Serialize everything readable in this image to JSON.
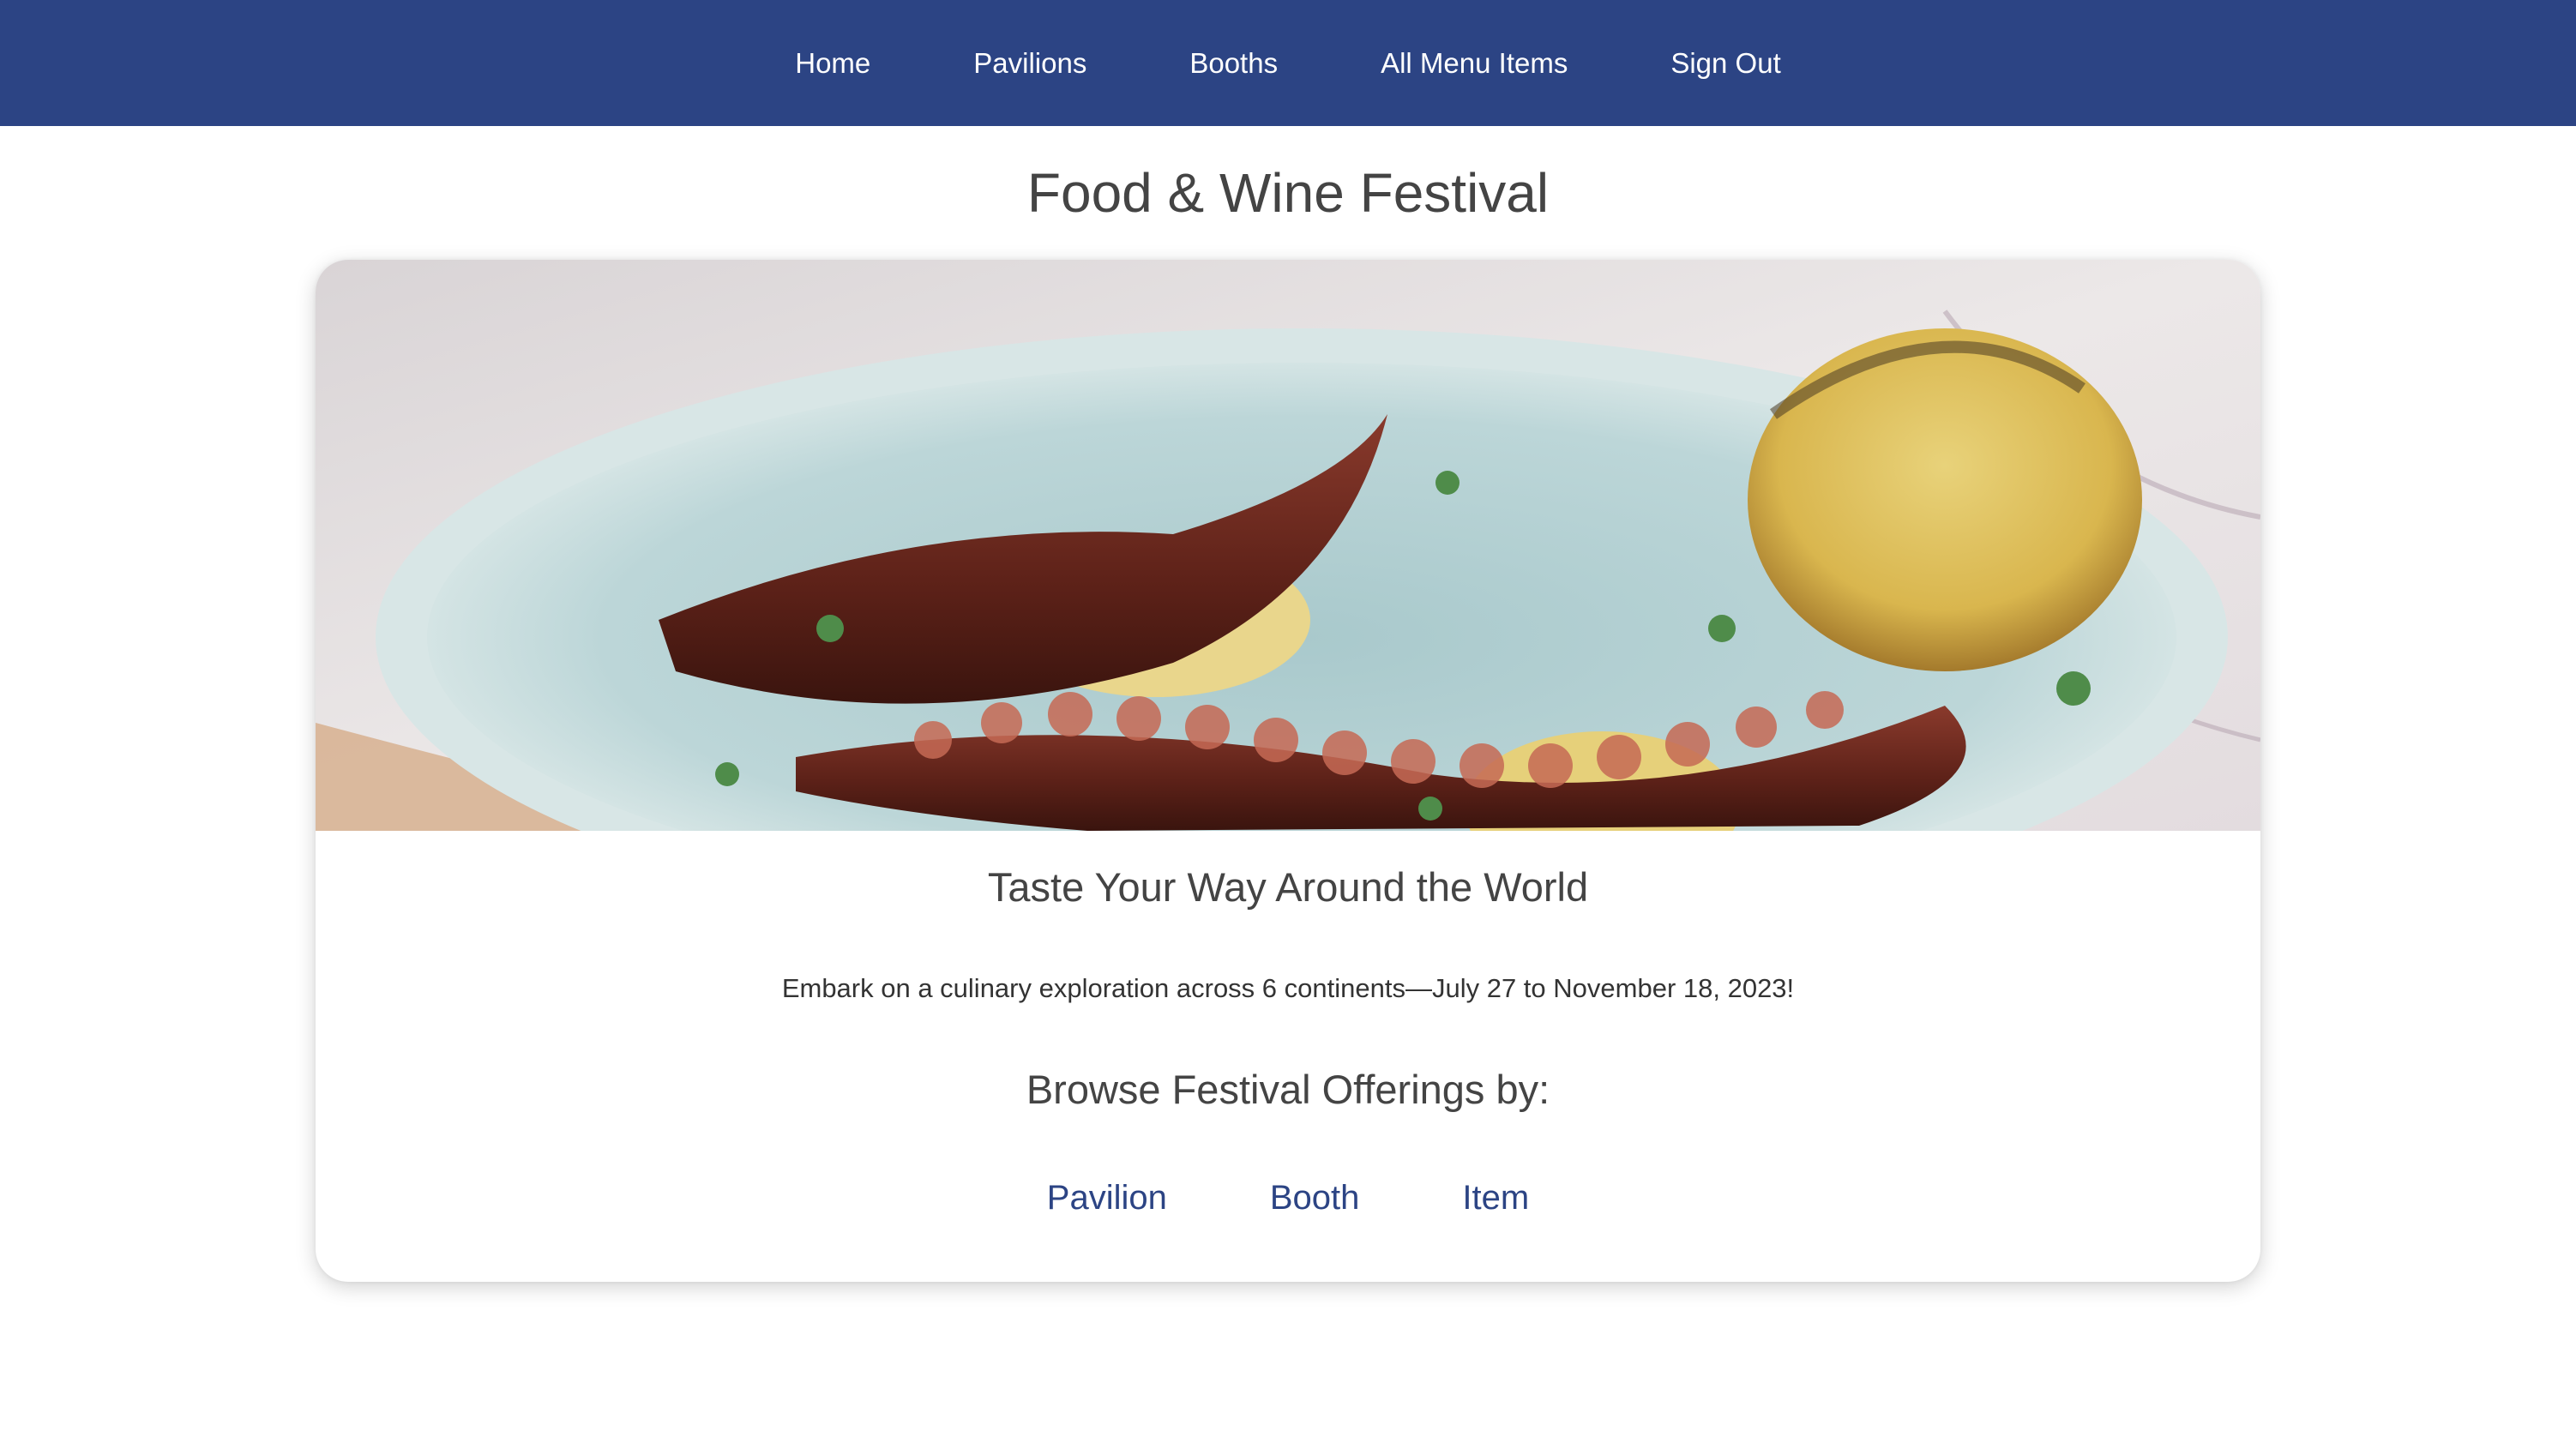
{
  "nav": {
    "items": [
      {
        "label": "Home"
      },
      {
        "label": "Pavilions"
      },
      {
        "label": "Booths"
      },
      {
        "label": "All Menu Items"
      },
      {
        "label": "Sign Out"
      }
    ]
  },
  "page": {
    "title": "Food & Wine Festival"
  },
  "card": {
    "tagline": "Taste Your Way Around the World",
    "intro": "Embark on a culinary exploration across 6 continents—July 27 to November 18, 2023!",
    "browse_heading": "Browse Festival Offerings by:",
    "browse_links": [
      {
        "label": "Pavilion"
      },
      {
        "label": "Booth"
      },
      {
        "label": "Item"
      }
    ]
  },
  "colors": {
    "nav_bg": "#2c4484",
    "link": "#2c4484",
    "heading": "#444444"
  }
}
